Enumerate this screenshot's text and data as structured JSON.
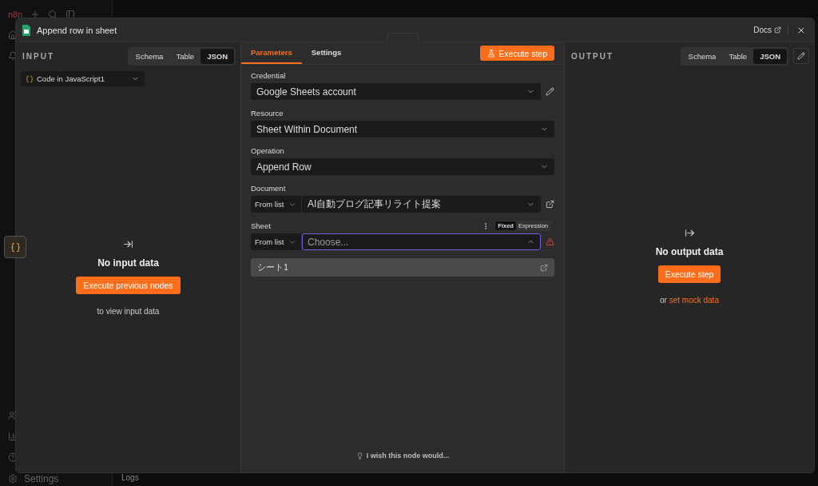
{
  "app": {
    "logo": "n8n",
    "settings": "Settings",
    "logs": "Logs"
  },
  "modal": {
    "title": "Append row in sheet",
    "docs": "Docs"
  },
  "input": {
    "heading": "INPUT",
    "view_tabs": [
      {
        "label": "Schema",
        "selected": false
      },
      {
        "label": "Table",
        "selected": false
      },
      {
        "label": "JSON",
        "selected": true
      }
    ],
    "node_select": "Code in JavaScript1",
    "empty_title": "No input data",
    "button": "Execute previous nodes",
    "hint": "to view input data"
  },
  "parameters": {
    "tabs": [
      {
        "label": "Parameters",
        "selected": true
      },
      {
        "label": "Settings",
        "selected": false
      }
    ],
    "execute": "Execute step",
    "fields": [
      {
        "kind": "select",
        "label": "Credential",
        "value": "Google Sheets account",
        "editable": true
      },
      {
        "kind": "select",
        "label": "Resource",
        "value": "Sheet Within Document"
      },
      {
        "kind": "select",
        "label": "Operation",
        "value": "Append Row"
      },
      {
        "kind": "locator",
        "label": "Document",
        "mode": "From list",
        "value": "AI自動ブログ記事リライト提案",
        "linked": true,
        "focused": false,
        "expanded": false
      },
      {
        "kind": "locator",
        "label": "Sheet",
        "mode": "From list",
        "placeholder": "Choose...",
        "error": true,
        "focused": true,
        "expanded": true,
        "mode_options": [
          {
            "label": "Fixed",
            "selected": true
          },
          {
            "label": "Expression",
            "selected": false
          }
        ],
        "options": [
          {
            "label": "シート1"
          }
        ]
      }
    ],
    "feedback": "I wish this node would..."
  },
  "output": {
    "heading": "OUTPUT",
    "view_tabs": [
      {
        "label": "Schema",
        "selected": false
      },
      {
        "label": "Table",
        "selected": false
      },
      {
        "label": "JSON",
        "selected": true
      }
    ],
    "empty_title": "No output data",
    "button": "Execute step",
    "hint": "or",
    "link": "set mock data"
  }
}
